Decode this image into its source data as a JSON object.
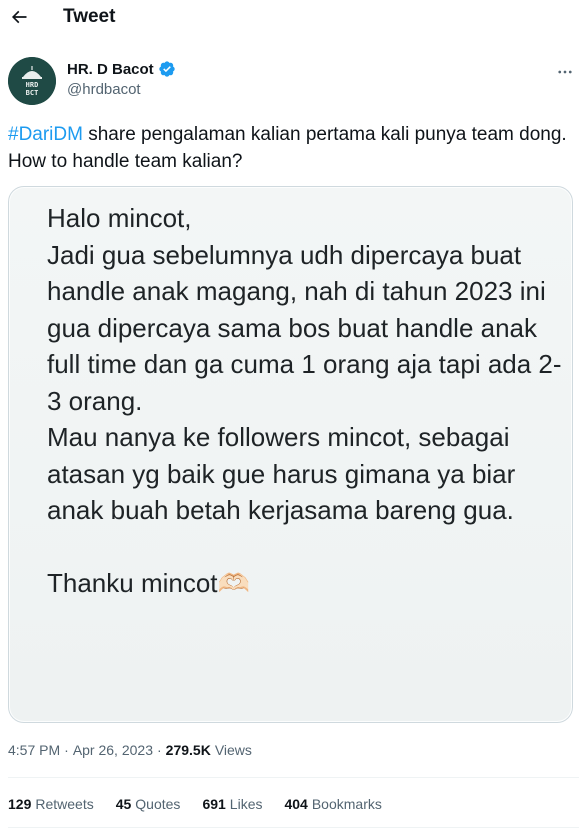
{
  "header": {
    "title": "Tweet",
    "back_icon": "arrow-left-icon"
  },
  "author": {
    "name": "HR. D Bacot",
    "handle": "@hrdbacot",
    "avatar_text_top": "HRD",
    "avatar_text_bottom": "BCT",
    "verified_icon": "verified-badge-icon",
    "verified_color": "#1d9bf0"
  },
  "tweet": {
    "hashtag": "#DariDM",
    "text": " share pengalaman kalian pertama kali punya team dong. How to handle team kalian?",
    "hashtag_color": "#1d9bf0"
  },
  "media": {
    "message": "Halo mincot,\nJadi gua sebelumnya udh dipercaya buat handle anak magang, nah di tahun 2023 ini gua dipercaya sama bos buat handle anak full time dan ga cuma 1 orang aja tapi ada 2-3 orang.\nMau nanya ke followers mincot, sebagai atasan yg baik gue harus gimana ya biar anak buah betah kerjasama bareng gua.\n\nThanku mincot🫶🏻"
  },
  "meta": {
    "time": "4:57 PM",
    "separator": "·",
    "date": "Apr 26, 2023",
    "views_count": "279.5K",
    "views_label": "Views"
  },
  "stats": {
    "retweets": {
      "count": "129",
      "label": "Retweets"
    },
    "quotes": {
      "count": "45",
      "label": "Quotes"
    },
    "likes": {
      "count": "691",
      "label": "Likes"
    },
    "bookmarks": {
      "count": "404",
      "label": "Bookmarks"
    }
  }
}
